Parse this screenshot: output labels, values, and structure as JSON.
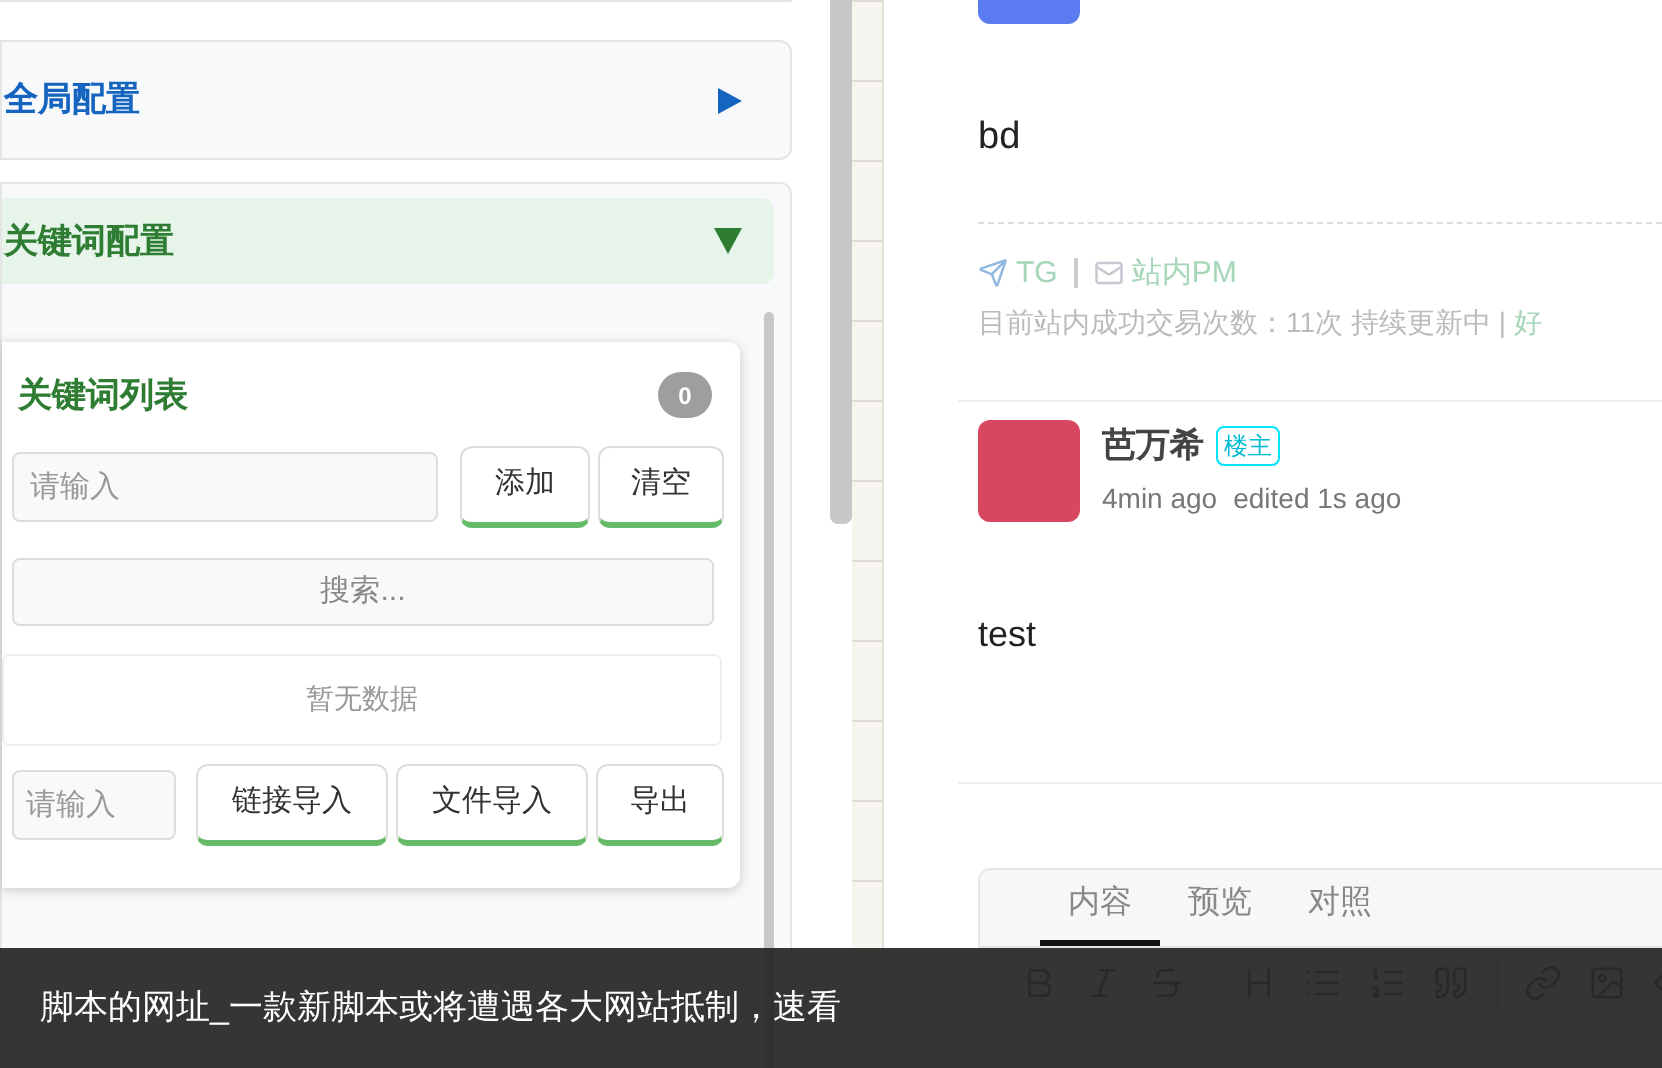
{
  "left_panel": {
    "sections": [
      {
        "title": "全局配置",
        "expanded": false
      },
      {
        "title": "关键词配置",
        "expanded": true
      }
    ],
    "keyword_list": {
      "title": "关键词列表",
      "count": "0",
      "input": {
        "placeholder": "请输入"
      },
      "buttons": [
        "添加",
        "清空"
      ],
      "search": {
        "placeholder": "搜索..."
      },
      "empty_text": "暂无数据",
      "bottom_input": {
        "placeholder": "请输入"
      },
      "bottom_buttons": [
        "链接导入",
        "文件导入",
        "导出"
      ]
    }
  },
  "posts": [
    {
      "body": "bd",
      "signature": {
        "links": [
          "TG",
          "站内PM"
        ],
        "line": "目前站内成功交易次数：11次 持续更新中 |",
        "link_tail": "好"
      }
    },
    {
      "author": "芭万希",
      "badge": "楼主",
      "time": "4min ago",
      "edited": "edited 1s ago",
      "body": "test"
    }
  ],
  "editor": {
    "tabs": [
      {
        "label": "内容",
        "selected": true
      },
      {
        "label": "预览",
        "selected": false
      },
      {
        "label": "对照",
        "selected": false
      }
    ]
  },
  "banner": {
    "text": "脚本的网址_一款新脚本或将遭遇各大网站抵制，速看"
  }
}
